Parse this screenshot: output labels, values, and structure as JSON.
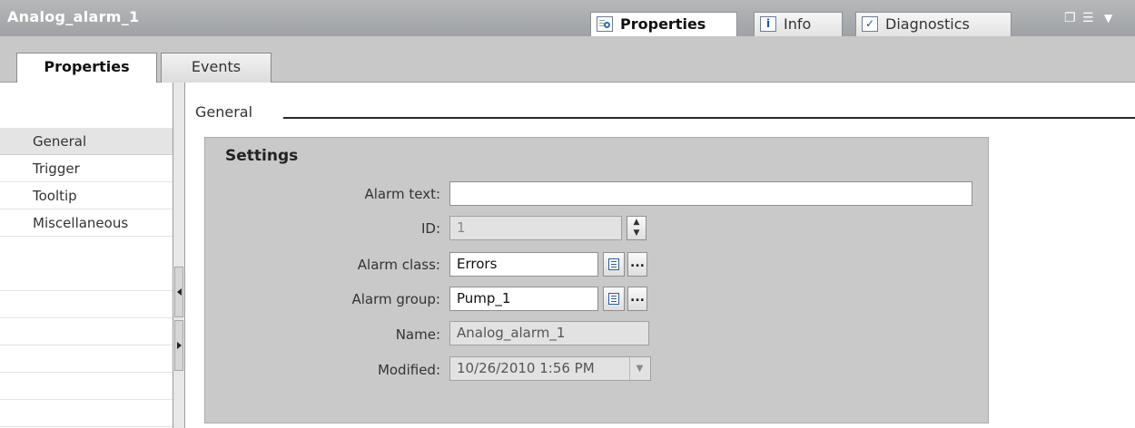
{
  "window": {
    "title": "Analog_alarm_1",
    "tabs": [
      {
        "label": "Properties",
        "icon": "properties-icon",
        "active": true
      },
      {
        "label": "Info",
        "icon": "info-icon",
        "active": false
      },
      {
        "label": "Diagnostics",
        "icon": "diagnostics-icon",
        "active": false
      }
    ],
    "controls": [
      "restore-icon",
      "list-icon",
      "dropdown-icon"
    ]
  },
  "subtabs": [
    {
      "label": "Properties",
      "active": true
    },
    {
      "label": "Events",
      "active": false
    }
  ],
  "nav": {
    "items": [
      {
        "label": "General",
        "selected": true
      },
      {
        "label": "Trigger",
        "selected": false
      },
      {
        "label": "Tooltip",
        "selected": false
      },
      {
        "label": "Miscellaneous",
        "selected": false
      }
    ]
  },
  "main": {
    "section_title": "General",
    "group_title": "Settings",
    "fields": {
      "alarm_text": {
        "label": "Alarm text:",
        "value": ""
      },
      "id": {
        "label": "ID:",
        "value": "1"
      },
      "alarm_class": {
        "label": "Alarm class:",
        "value": "Errors"
      },
      "alarm_group": {
        "label": "Alarm group:",
        "value": "Pump_1"
      },
      "name": {
        "label": "Name:",
        "value": "Analog_alarm_1"
      },
      "modified": {
        "label": "Modified:",
        "value": "10/26/2010 1:56 PM"
      }
    }
  }
}
